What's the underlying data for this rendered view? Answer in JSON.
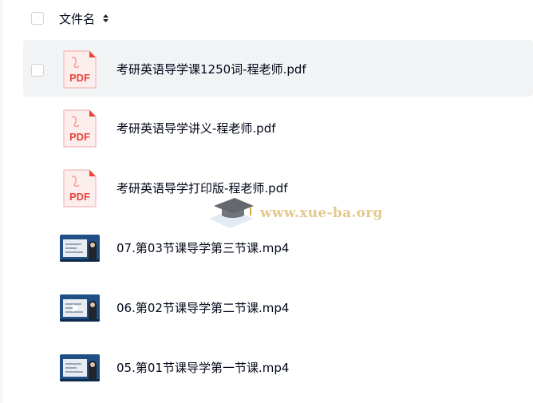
{
  "header": {
    "column_label": "文件名"
  },
  "files": [
    {
      "name": "考研英语导学课1250词-程老师.pdf",
      "type": "pdf",
      "icon": "pdf-icon",
      "icon_text": "PDF",
      "hovered": true
    },
    {
      "name": "考研英语导学讲义-程老师.pdf",
      "type": "pdf",
      "icon": "pdf-icon",
      "icon_text": "PDF"
    },
    {
      "name": "考研英语导学打印版-程老师.pdf",
      "type": "pdf",
      "icon": "pdf-icon",
      "icon_text": "PDF"
    },
    {
      "name": "07.第03节课导学第三节课.mp4",
      "type": "video",
      "icon": "video-thumbnail"
    },
    {
      "name": "06.第02节课导学第二节课.mp4",
      "type": "video",
      "icon": "video-thumbnail",
      "play_overlay": true
    },
    {
      "name": "05.第01节课导学第一节课.mp4",
      "type": "video",
      "icon": "video-thumbnail"
    }
  ],
  "watermark": {
    "text": "www.xue-ba.org"
  },
  "colors": {
    "text": "#03081a",
    "hover_row": "#f2f3f5",
    "checkbox_border": "#d0d3da",
    "pdf_red": "#e8453c",
    "watermark": "#e4c98c"
  }
}
